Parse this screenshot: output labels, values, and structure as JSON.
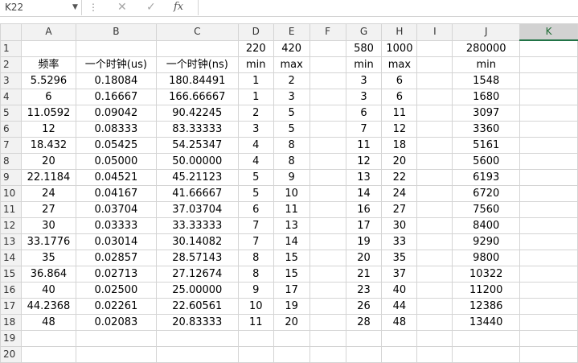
{
  "formula_bar": {
    "name_box": "K22",
    "name_box_arrow": "▼",
    "dots": "⋮",
    "cancel_icon": "✕",
    "enter_icon": "✓",
    "fx_icon": "fx",
    "formula_value": ""
  },
  "columns": [
    "A",
    "B",
    "C",
    "D",
    "E",
    "F",
    "G",
    "H",
    "I",
    "J",
    "K"
  ],
  "selected_column": "K",
  "rows": [
    {
      "num": "1",
      "cells": [
        "",
        "",
        "",
        "220",
        "420",
        "",
        "580",
        "1000",
        "",
        "280000",
        ""
      ]
    },
    {
      "num": "2",
      "cells": [
        "频率",
        "一个时钟(us)",
        "一个时钟(ns)",
        "min",
        "max",
        "",
        "min",
        "max",
        "",
        "min",
        ""
      ]
    },
    {
      "num": "3",
      "cells": [
        "5.5296",
        "0.18084",
        "180.84491",
        "1",
        "2",
        "",
        "3",
        "6",
        "",
        "1548",
        ""
      ]
    },
    {
      "num": "4",
      "cells": [
        "6",
        "0.16667",
        "166.66667",
        "1",
        "3",
        "",
        "3",
        "6",
        "",
        "1680",
        ""
      ]
    },
    {
      "num": "5",
      "cells": [
        "11.0592",
        "0.09042",
        "90.42245",
        "2",
        "5",
        "",
        "6",
        "11",
        "",
        "3097",
        ""
      ]
    },
    {
      "num": "6",
      "cells": [
        "12",
        "0.08333",
        "83.33333",
        "3",
        "5",
        "",
        "7",
        "12",
        "",
        "3360",
        ""
      ]
    },
    {
      "num": "7",
      "cells": [
        "18.432",
        "0.05425",
        "54.25347",
        "4",
        "8",
        "",
        "11",
        "18",
        "",
        "5161",
        ""
      ]
    },
    {
      "num": "8",
      "cells": [
        "20",
        "0.05000",
        "50.00000",
        "4",
        "8",
        "",
        "12",
        "20",
        "",
        "5600",
        ""
      ]
    },
    {
      "num": "9",
      "cells": [
        "22.1184",
        "0.04521",
        "45.21123",
        "5",
        "9",
        "",
        "13",
        "22",
        "",
        "6193",
        ""
      ]
    },
    {
      "num": "10",
      "cells": [
        "24",
        "0.04167",
        "41.66667",
        "5",
        "10",
        "",
        "14",
        "24",
        "",
        "6720",
        ""
      ]
    },
    {
      "num": "11",
      "cells": [
        "27",
        "0.03704",
        "37.03704",
        "6",
        "11",
        "",
        "16",
        "27",
        "",
        "7560",
        ""
      ]
    },
    {
      "num": "12",
      "cells": [
        "30",
        "0.03333",
        "33.33333",
        "7",
        "13",
        "",
        "17",
        "30",
        "",
        "8400",
        ""
      ]
    },
    {
      "num": "13",
      "cells": [
        "33.1776",
        "0.03014",
        "30.14082",
        "7",
        "14",
        "",
        "19",
        "33",
        "",
        "9290",
        ""
      ]
    },
    {
      "num": "14",
      "cells": [
        "35",
        "0.02857",
        "28.57143",
        "8",
        "15",
        "",
        "20",
        "35",
        "",
        "9800",
        ""
      ]
    },
    {
      "num": "15",
      "cells": [
        "36.864",
        "0.02713",
        "27.12674",
        "8",
        "15",
        "",
        "21",
        "37",
        "",
        "10322",
        ""
      ]
    },
    {
      "num": "16",
      "cells": [
        "40",
        "0.02500",
        "25.00000",
        "9",
        "17",
        "",
        "23",
        "40",
        "",
        "11200",
        ""
      ]
    },
    {
      "num": "17",
      "cells": [
        "44.2368",
        "0.02261",
        "22.60561",
        "10",
        "19",
        "",
        "26",
        "44",
        "",
        "12386",
        ""
      ]
    },
    {
      "num": "18",
      "cells": [
        "48",
        "0.02083",
        "20.83333",
        "11",
        "20",
        "",
        "28",
        "48",
        "",
        "13440",
        ""
      ]
    },
    {
      "num": "19",
      "cells": [
        "",
        "",
        "",
        "",
        "",
        "",
        "",
        "",
        "",
        "",
        ""
      ]
    },
    {
      "num": "20",
      "cells": [
        "",
        "",
        "",
        "",
        "",
        "",
        "",
        "",
        "",
        "",
        ""
      ]
    }
  ]
}
